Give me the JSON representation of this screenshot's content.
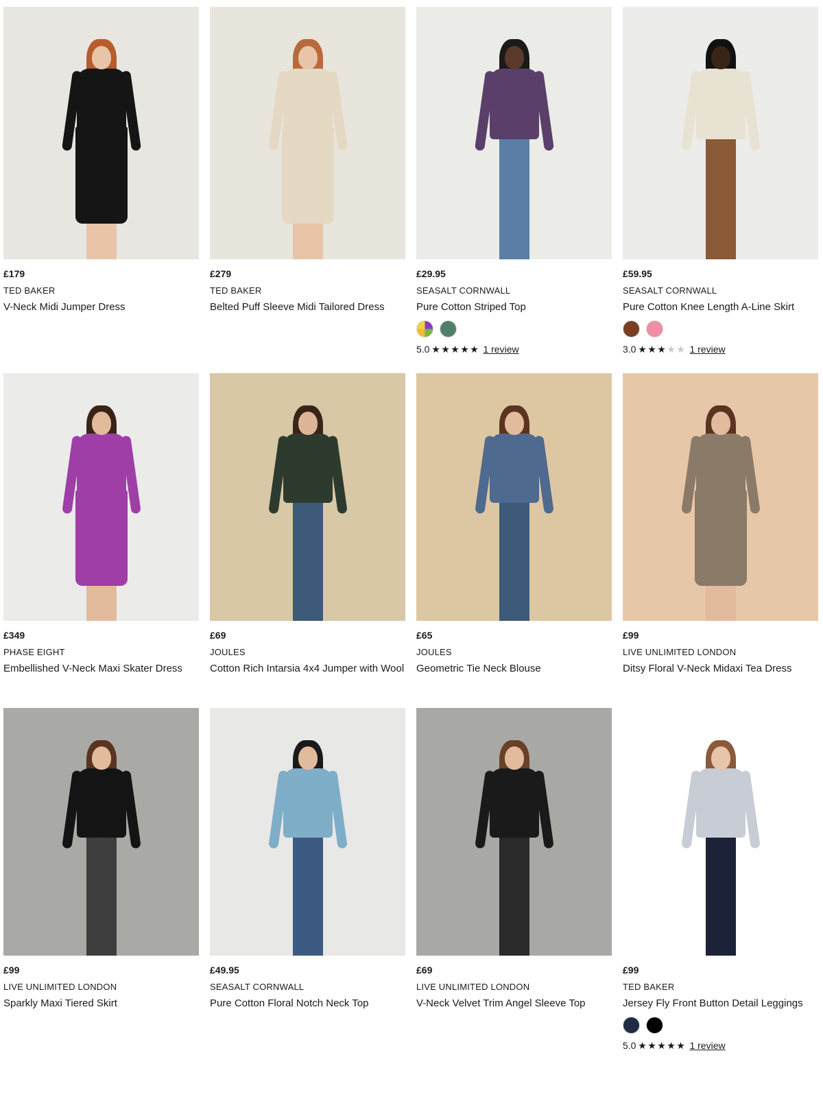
{
  "products": [
    {
      "price": "£179",
      "brand": "TED BAKER",
      "title": "V-Neck Midi Jumper Dress",
      "bg": "#e8e6e0",
      "top": "#151515",
      "bottom": "#151515",
      "skin": "#e8c4a8",
      "hair": "#b85c2e",
      "swatches": [],
      "rating": null
    },
    {
      "price": "£279",
      "brand": "TED BAKER",
      "title": "Belted Puff Sleeve Midi Tailored Dress",
      "bg": "#e8e5dd",
      "top": "#e5d9c3",
      "bottom": "#e5d9c3",
      "skin": "#e8c4a8",
      "hair": "#b86a3a",
      "swatches": [],
      "rating": null
    },
    {
      "price": "£29.95",
      "brand": "SEASALT CORNWALL",
      "title": "Pure Cotton Striped Top",
      "bg": "#ebebe7",
      "top": "#5a3f6a",
      "bottom": "#5a7ea6",
      "skin": "#5a3a2a",
      "hair": "#1a1a1a",
      "swatches": [
        "multicolour",
        "#4f7f6b"
      ],
      "rating": {
        "score": "5.0",
        "stars": 5,
        "reviews": "1 review"
      }
    },
    {
      "price": "£59.95",
      "brand": "SEASALT CORNWALL",
      "title": "Pure Cotton Knee Length A-Line Skirt",
      "bg": "#ececea",
      "top": "#e8e2d3",
      "bottom": "#8b5a36",
      "skin": "#3a2418",
      "hair": "#111111",
      "swatches": [
        "#7a3e22",
        "#ef8ea5"
      ],
      "rating": {
        "score": "3.0",
        "stars": 3,
        "reviews": "1 review"
      }
    },
    {
      "price": "£349",
      "brand": "PHASE EIGHT",
      "title": "Embellished V-Neck Maxi Skater Dress",
      "bg": "#ebebea",
      "top": "#a03ea8",
      "bottom": "#a03ea8",
      "skin": "#e2bb9c",
      "hair": "#3a2418",
      "swatches": [],
      "rating": null
    },
    {
      "price": "£69",
      "brand": "JOULES",
      "title": "Cotton Rich Intarsia 4x4 Jumper with Wool",
      "bg": "#d8c8a6",
      "top": "#2d3b2f",
      "bottom": "#3d5a78",
      "skin": "#dcb598",
      "hair": "#3a2418",
      "swatches": [],
      "rating": null
    },
    {
      "price": "£65",
      "brand": "JOULES",
      "title": "Geometric Tie Neck Blouse",
      "bg": "#ddc7a2",
      "top": "#4e6a8e",
      "bottom": "#3d5a78",
      "skin": "#e2bb9c",
      "hair": "#5a3420",
      "swatches": [],
      "rating": null
    },
    {
      "price": "£99",
      "brand": "LIVE UNLIMITED LONDON",
      "title": "Ditsy Floral V-Neck Midaxi Tea Dress",
      "bg": "#e6c7a8",
      "top": "#8a7a68",
      "bottom": "#8a7a68",
      "skin": "#e2bb9c",
      "hair": "#5a3420",
      "swatches": [],
      "rating": null
    },
    {
      "price": "£99",
      "brand": "LIVE UNLIMITED LONDON",
      "title": "Sparkly Maxi Tiered Skirt",
      "bg": "#a9a9a6",
      "top": "#141414",
      "bottom": "#3e3e3e",
      "skin": "#e2bb9c",
      "hair": "#5a3420",
      "swatches": [],
      "rating": null
    },
    {
      "price": "£49.95",
      "brand": "SEASALT CORNWALL",
      "title": "Pure Cotton Floral Notch Neck Top",
      "bg": "#e8e8e6",
      "top": "#7faec8",
      "bottom": "#3d5a82",
      "skin": "#e2bb9c",
      "hair": "#1a1a1a",
      "swatches": [],
      "rating": null
    },
    {
      "price": "£69",
      "brand": "LIVE UNLIMITED LONDON",
      "title": "V-Neck Velvet Trim Angel Sleeve Top",
      "bg": "#a8a8a5",
      "top": "#1a1a1a",
      "bottom": "#2a2a2a",
      "skin": "#e2bb9c",
      "hair": "#6a4028",
      "swatches": [],
      "rating": null
    },
    {
      "price": "£99",
      "brand": "TED BAKER",
      "title": "Jersey Fly Front Button Detail Leggings",
      "bg": "#ffffff",
      "top": "#c8ccd4",
      "bottom": "#1c2238",
      "skin": "#e8c4a8",
      "hair": "#8a5a3a",
      "swatches": [
        "#1f2a44",
        "#000000"
      ],
      "rating": {
        "score": "5.0",
        "stars": 5,
        "reviews": "1 review"
      }
    }
  ]
}
